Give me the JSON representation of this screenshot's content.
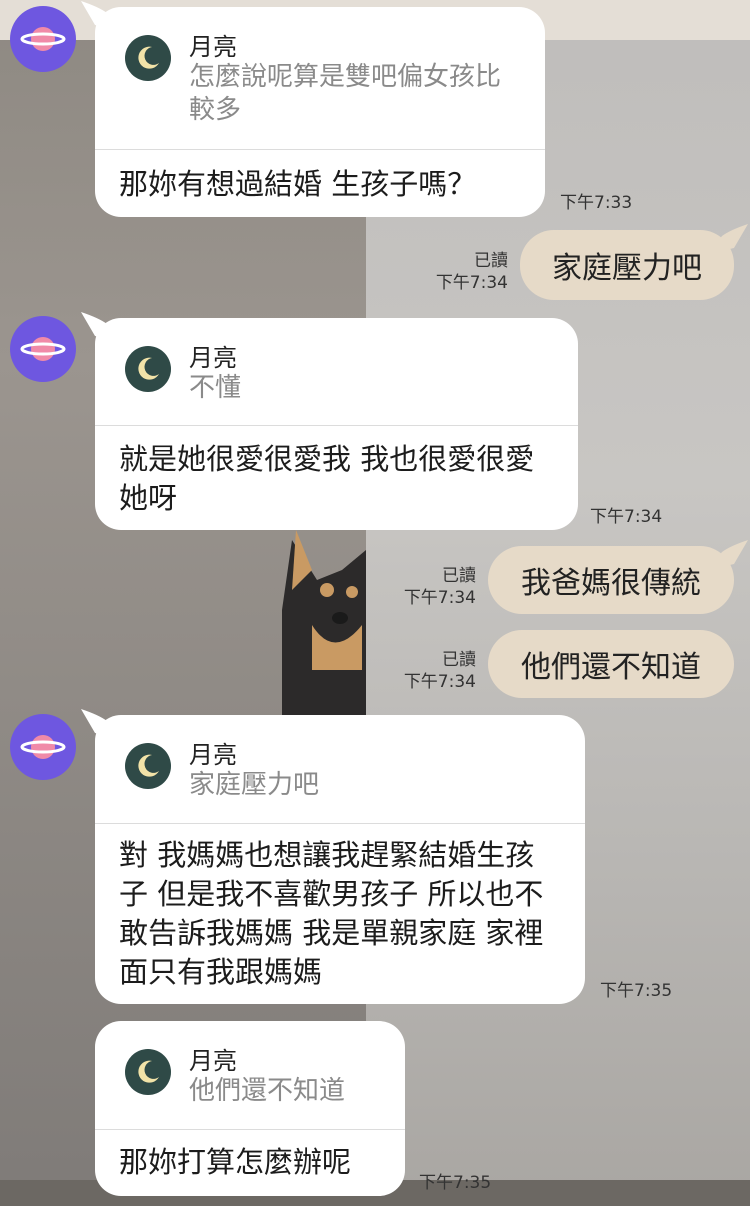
{
  "contact": {
    "quote_name": "月亮"
  },
  "messages": {
    "in1": {
      "quote": "怎麼說呢算是雙吧偏女孩比較多",
      "text": "那妳有想過結婚 生孩子嗎？",
      "time": "下午7:33"
    },
    "out1": {
      "text": "家庭壓力吧",
      "read": "已讀",
      "time": "下午7:34"
    },
    "in2": {
      "quote": "不懂",
      "text": "就是她很愛很愛我 我也很愛很愛她呀",
      "time": "下午7:34"
    },
    "out2": {
      "text": "我爸媽很傳統",
      "read": "已讀",
      "time": "下午7:34"
    },
    "out3": {
      "text": "他們還不知道",
      "read": "已讀",
      "time": "下午7:34"
    },
    "in3": {
      "quote": "家庭壓力吧",
      "text": "對 我媽媽也想讓我趕緊結婚生孩子 但是我不喜歡男孩子 所以也不敢告訴我媽媽 我是單親家庭 家裡面只有我跟媽媽",
      "time": "下午7:35"
    },
    "in4": {
      "quote": "他們還不知道",
      "text": "那妳打算怎麼辦呢",
      "time": "下午7:35"
    }
  },
  "icons": {
    "avatar": "planet-icon",
    "quote": "moon-icon"
  },
  "colors": {
    "incoming": "#ffffff",
    "outgoing": "#e6dac8",
    "avatar": "#6e57e0",
    "moon_bg": "#2f4a47"
  }
}
